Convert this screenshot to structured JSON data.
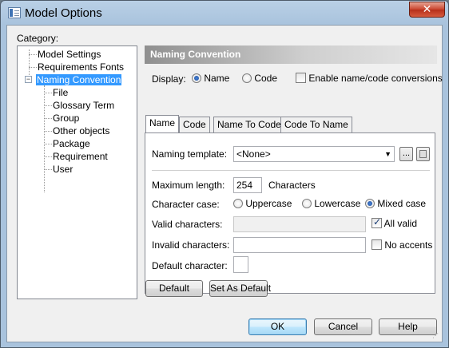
{
  "window": {
    "title": "Model Options",
    "close_glyph": "✕"
  },
  "category": {
    "label": "Category:",
    "items": [
      {
        "label": "Model Settings",
        "level": 0
      },
      {
        "label": "Requirements Fonts",
        "level": 0
      },
      {
        "label": "Naming Convention",
        "level": 0,
        "selected": true,
        "expanded": true
      },
      {
        "label": "File",
        "level": 1
      },
      {
        "label": "Glossary Term",
        "level": 1
      },
      {
        "label": "Group",
        "level": 1
      },
      {
        "label": "Other objects",
        "level": 1
      },
      {
        "label": "Package",
        "level": 1
      },
      {
        "label": "Requirement",
        "level": 1
      },
      {
        "label": "User",
        "level": 1
      }
    ],
    "expander_glyph": "−"
  },
  "panel": {
    "header": "Naming Convention",
    "display": {
      "label": "Display:",
      "options": [
        "Name",
        "Code"
      ],
      "selected": "Name",
      "conversion_label": "Enable name/code conversions",
      "conversion_checked": false
    },
    "tabs": [
      "Name",
      "Code",
      "Name To Code",
      "Code To Name"
    ],
    "active_tab": "Name",
    "naming_template": {
      "label": "Naming template:",
      "value": "<None>",
      "ellipsis": "...",
      "arrow": "▼"
    },
    "max_length": {
      "label": "Maximum length:",
      "value": "254",
      "unit": "Characters"
    },
    "character_case": {
      "label": "Character case:",
      "options": [
        "Uppercase",
        "Lowercase",
        "Mixed case"
      ],
      "selected": "Mixed case"
    },
    "valid_characters": {
      "label": "Valid characters:",
      "value": "",
      "all_valid_label": "All valid",
      "all_valid_checked": true
    },
    "invalid_characters": {
      "label": "Invalid characters:",
      "value": "",
      "no_accents_label": "No accents",
      "no_accents_checked": false
    },
    "default_character": {
      "label": "Default character:",
      "value": ""
    },
    "default_button": "Default",
    "set_as_default_button": "Set As Default"
  },
  "footer": {
    "ok": "OK",
    "cancel": "Cancel",
    "help": "Help"
  },
  "colors": {
    "selection": "#3399ff",
    "header_gradient_start": "#8f8f8f",
    "close": "#c9432c"
  }
}
